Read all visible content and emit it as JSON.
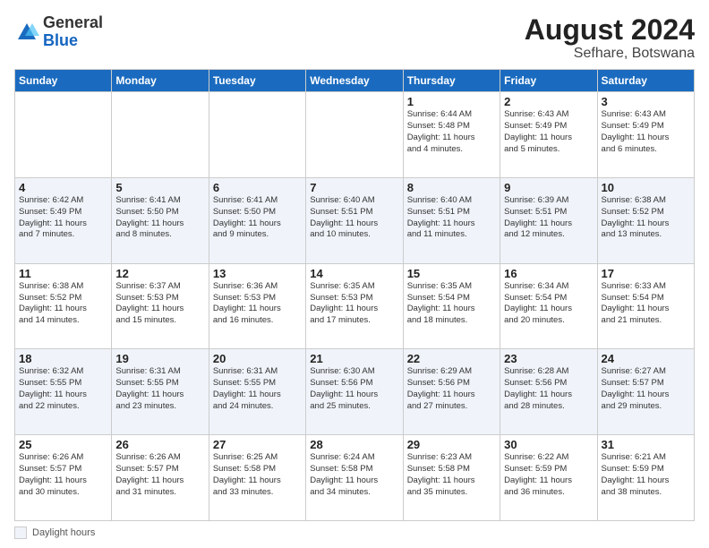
{
  "logo": {
    "general": "General",
    "blue": "Blue"
  },
  "title": "August 2024",
  "subtitle": "Sefhare, Botswana",
  "days_of_week": [
    "Sunday",
    "Monday",
    "Tuesday",
    "Wednesday",
    "Thursday",
    "Friday",
    "Saturday"
  ],
  "footer_label": "Daylight hours",
  "weeks": [
    [
      {
        "day": "",
        "info": ""
      },
      {
        "day": "",
        "info": ""
      },
      {
        "day": "",
        "info": ""
      },
      {
        "day": "",
        "info": ""
      },
      {
        "day": "1",
        "info": "Sunrise: 6:44 AM\nSunset: 5:48 PM\nDaylight: 11 hours\nand 4 minutes."
      },
      {
        "day": "2",
        "info": "Sunrise: 6:43 AM\nSunset: 5:49 PM\nDaylight: 11 hours\nand 5 minutes."
      },
      {
        "day": "3",
        "info": "Sunrise: 6:43 AM\nSunset: 5:49 PM\nDaylight: 11 hours\nand 6 minutes."
      }
    ],
    [
      {
        "day": "4",
        "info": "Sunrise: 6:42 AM\nSunset: 5:49 PM\nDaylight: 11 hours\nand 7 minutes."
      },
      {
        "day": "5",
        "info": "Sunrise: 6:41 AM\nSunset: 5:50 PM\nDaylight: 11 hours\nand 8 minutes."
      },
      {
        "day": "6",
        "info": "Sunrise: 6:41 AM\nSunset: 5:50 PM\nDaylight: 11 hours\nand 9 minutes."
      },
      {
        "day": "7",
        "info": "Sunrise: 6:40 AM\nSunset: 5:51 PM\nDaylight: 11 hours\nand 10 minutes."
      },
      {
        "day": "8",
        "info": "Sunrise: 6:40 AM\nSunset: 5:51 PM\nDaylight: 11 hours\nand 11 minutes."
      },
      {
        "day": "9",
        "info": "Sunrise: 6:39 AM\nSunset: 5:51 PM\nDaylight: 11 hours\nand 12 minutes."
      },
      {
        "day": "10",
        "info": "Sunrise: 6:38 AM\nSunset: 5:52 PM\nDaylight: 11 hours\nand 13 minutes."
      }
    ],
    [
      {
        "day": "11",
        "info": "Sunrise: 6:38 AM\nSunset: 5:52 PM\nDaylight: 11 hours\nand 14 minutes."
      },
      {
        "day": "12",
        "info": "Sunrise: 6:37 AM\nSunset: 5:53 PM\nDaylight: 11 hours\nand 15 minutes."
      },
      {
        "day": "13",
        "info": "Sunrise: 6:36 AM\nSunset: 5:53 PM\nDaylight: 11 hours\nand 16 minutes."
      },
      {
        "day": "14",
        "info": "Sunrise: 6:35 AM\nSunset: 5:53 PM\nDaylight: 11 hours\nand 17 minutes."
      },
      {
        "day": "15",
        "info": "Sunrise: 6:35 AM\nSunset: 5:54 PM\nDaylight: 11 hours\nand 18 minutes."
      },
      {
        "day": "16",
        "info": "Sunrise: 6:34 AM\nSunset: 5:54 PM\nDaylight: 11 hours\nand 20 minutes."
      },
      {
        "day": "17",
        "info": "Sunrise: 6:33 AM\nSunset: 5:54 PM\nDaylight: 11 hours\nand 21 minutes."
      }
    ],
    [
      {
        "day": "18",
        "info": "Sunrise: 6:32 AM\nSunset: 5:55 PM\nDaylight: 11 hours\nand 22 minutes."
      },
      {
        "day": "19",
        "info": "Sunrise: 6:31 AM\nSunset: 5:55 PM\nDaylight: 11 hours\nand 23 minutes."
      },
      {
        "day": "20",
        "info": "Sunrise: 6:31 AM\nSunset: 5:55 PM\nDaylight: 11 hours\nand 24 minutes."
      },
      {
        "day": "21",
        "info": "Sunrise: 6:30 AM\nSunset: 5:56 PM\nDaylight: 11 hours\nand 25 minutes."
      },
      {
        "day": "22",
        "info": "Sunrise: 6:29 AM\nSunset: 5:56 PM\nDaylight: 11 hours\nand 27 minutes."
      },
      {
        "day": "23",
        "info": "Sunrise: 6:28 AM\nSunset: 5:56 PM\nDaylight: 11 hours\nand 28 minutes."
      },
      {
        "day": "24",
        "info": "Sunrise: 6:27 AM\nSunset: 5:57 PM\nDaylight: 11 hours\nand 29 minutes."
      }
    ],
    [
      {
        "day": "25",
        "info": "Sunrise: 6:26 AM\nSunset: 5:57 PM\nDaylight: 11 hours\nand 30 minutes."
      },
      {
        "day": "26",
        "info": "Sunrise: 6:26 AM\nSunset: 5:57 PM\nDaylight: 11 hours\nand 31 minutes."
      },
      {
        "day": "27",
        "info": "Sunrise: 6:25 AM\nSunset: 5:58 PM\nDaylight: 11 hours\nand 33 minutes."
      },
      {
        "day": "28",
        "info": "Sunrise: 6:24 AM\nSunset: 5:58 PM\nDaylight: 11 hours\nand 34 minutes."
      },
      {
        "day": "29",
        "info": "Sunrise: 6:23 AM\nSunset: 5:58 PM\nDaylight: 11 hours\nand 35 minutes."
      },
      {
        "day": "30",
        "info": "Sunrise: 6:22 AM\nSunset: 5:59 PM\nDaylight: 11 hours\nand 36 minutes."
      },
      {
        "day": "31",
        "info": "Sunrise: 6:21 AM\nSunset: 5:59 PM\nDaylight: 11 hours\nand 38 minutes."
      }
    ]
  ]
}
